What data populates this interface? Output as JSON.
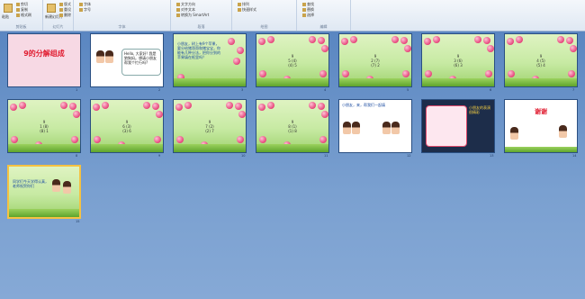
{
  "ribbon": {
    "groups": [
      {
        "label": "剪贴板",
        "items": [
          "剪切",
          "复制",
          "格式刷"
        ],
        "big": "粘贴"
      },
      {
        "label": "幻灯片",
        "items": [
          "版式",
          "重设",
          "删除"
        ],
        "big": "新建幻灯片"
      },
      {
        "label": "字体",
        "items": [
          "字体",
          "字号"
        ]
      },
      {
        "label": "段落",
        "items": [
          "文字方向",
          "对齐文本",
          "转换为 SmartArt"
        ]
      },
      {
        "label": "绘图",
        "items": [
          "排列",
          "快速样式"
        ]
      },
      {
        "label": "编辑",
        "items": [
          "查找",
          "替换",
          "选择"
        ]
      }
    ]
  },
  "slides": [
    {
      "num": "1",
      "title": "9的分解组成"
    },
    {
      "num": "2",
      "text": "Hello, 大家好! 我是狼狗妈。想请小朋友帮我个忙行吗?"
    },
    {
      "num": "3",
      "text": "小朋友，树上有9个苹果，要分给猪哥哥和猪宝宝，你能有几种分法，把你分到的苹果填在框里吗？"
    },
    {
      "num": "4",
      "math": [
        "9",
        "5 (4)",
        "(4) 5"
      ]
    },
    {
      "num": "5",
      "math": [
        "9",
        "2 (7)",
        "(7) 2"
      ]
    },
    {
      "num": "6",
      "math": [
        "9",
        "3 (6)",
        "(6) 3"
      ]
    },
    {
      "num": "7",
      "math": [
        "9",
        "4 (5)",
        "(5) 4"
      ]
    },
    {
      "num": "8",
      "math": [
        "9",
        "1 (8)",
        "(8) 1"
      ]
    },
    {
      "num": "9",
      "math": [
        "9",
        "6 (3)",
        "(3) 6"
      ]
    },
    {
      "num": "10",
      "math": [
        "9",
        "7 (2)",
        "(2) 7"
      ]
    },
    {
      "num": "11",
      "math": [
        "9",
        "8 (1)",
        "(1) 8"
      ]
    },
    {
      "num": "12",
      "text": "小朋友，来，帮我们一起填"
    },
    {
      "num": "13",
      "text": "小朋友的表演很精彩"
    },
    {
      "num": "14",
      "text": "谢谢"
    },
    {
      "num": "15",
      "text": "同学们今天学得认真，老师祝贺你们"
    }
  ]
}
